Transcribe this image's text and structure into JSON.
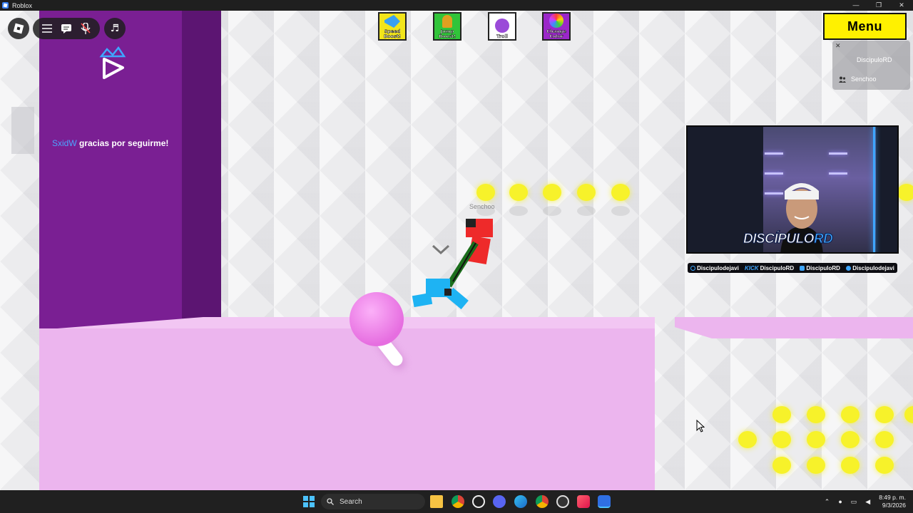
{
  "window": {
    "title": "Roblox",
    "controls": [
      "—",
      "❐",
      "✕"
    ]
  },
  "game": {
    "wall_message": {
      "user": "SxidW",
      "text": " gracias por seguirme!"
    },
    "character_name": "Senchoo",
    "colors": {
      "wall": "#7a1f93",
      "floor": "#ecb5ee",
      "coin": "#f7f22a",
      "ball": "#e66ee0"
    }
  },
  "toolbar": {
    "roblox_icon": "roblox-logo-icon",
    "icons": [
      "hamburger-icon",
      "chat-icon",
      "mic-muted-icon"
    ],
    "music_icon": "music-note-icon"
  },
  "gamepasses": [
    {
      "label_1": "Speed",
      "label_2": "Boost!",
      "bg": "#f2e51a",
      "art": "#3aa0f0"
    },
    {
      "label_1": "Jump",
      "label_2": "Boost!",
      "bg": "#31c43a",
      "art": "#e0a020"
    },
    {
      "label_1": "Troll",
      "label_2": "",
      "bg": "#ffffff",
      "art": "#9a4ad8"
    },
    {
      "label_1": "Change",
      "label_2": "Color",
      "bg": "#9b27c9",
      "art": "#f0a030"
    }
  ],
  "menu": {
    "label": "Menu"
  },
  "player_list": {
    "close": "✕",
    "players": [
      "DiscipuloRD",
      "Senchoo"
    ]
  },
  "webcam": {
    "brand_1": "DISCÍPULO",
    "brand_2": "RD",
    "socials": [
      {
        "prefix": "",
        "handle": "Discipulodejavi",
        "icon_color": "#3ea6ff"
      },
      {
        "prefix": "KICK",
        "handle": "DiscipuloRD",
        "icon_color": ""
      },
      {
        "prefix": "",
        "handle": "DiscipuloRD",
        "icon_color": "#3ea6ff"
      },
      {
        "prefix": "",
        "handle": "Discipulodejavi",
        "icon_color": "#3ea6ff"
      }
    ]
  },
  "taskbar": {
    "search_placeholder": "Search",
    "time": "8:49 p. m.",
    "date": "9/3/2026",
    "apps": [
      "file-explorer-icon",
      "chrome-icon",
      "chatgpt-icon",
      "discord-icon",
      "edge-icon",
      "chrome-profile-icon",
      "obs-icon",
      "music-app-icon",
      "roblox-taskbar-icon"
    ]
  }
}
